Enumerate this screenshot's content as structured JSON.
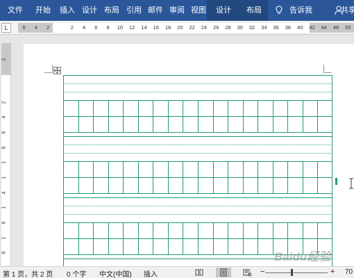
{
  "ribbon": {
    "tabs": [
      "文件",
      "开始",
      "插入",
      "设计",
      "布局",
      "引用",
      "邮件",
      "审阅",
      "视图"
    ],
    "context_tabs": [
      "设计",
      "布局"
    ],
    "tell_me": "告诉我",
    "share": "共享",
    "icons": [
      "lightbulb-icon",
      "person-icon"
    ],
    "color": "#2b579a"
  },
  "ruler": {
    "corner": "L",
    "ticks": [
      "6",
      "4",
      "2",
      "",
      "2",
      "4",
      "6",
      "8",
      "10",
      "12",
      "14",
      "16",
      "18",
      "20",
      "22",
      "24",
      "26",
      "28",
      "30",
      "32",
      "34",
      "36",
      "38",
      "40",
      "42",
      "44",
      "48",
      "50"
    ]
  },
  "vruler": {
    "ticks": [
      "2",
      "2",
      "4",
      "6",
      "8",
      "1",
      "1",
      "4",
      "1",
      "6",
      "1",
      "8"
    ]
  },
  "grid": {
    "color": "#1f9d6b",
    "columns": 18,
    "blocks": 3
  },
  "status": {
    "page": "第 1 页，共 2 页",
    "words": "0 个字",
    "language": "中文(中国)",
    "mode": "插入",
    "zoom_minus": "−",
    "zoom_plus": "+",
    "zoom": "70"
  },
  "watermark": "Baidu经验"
}
